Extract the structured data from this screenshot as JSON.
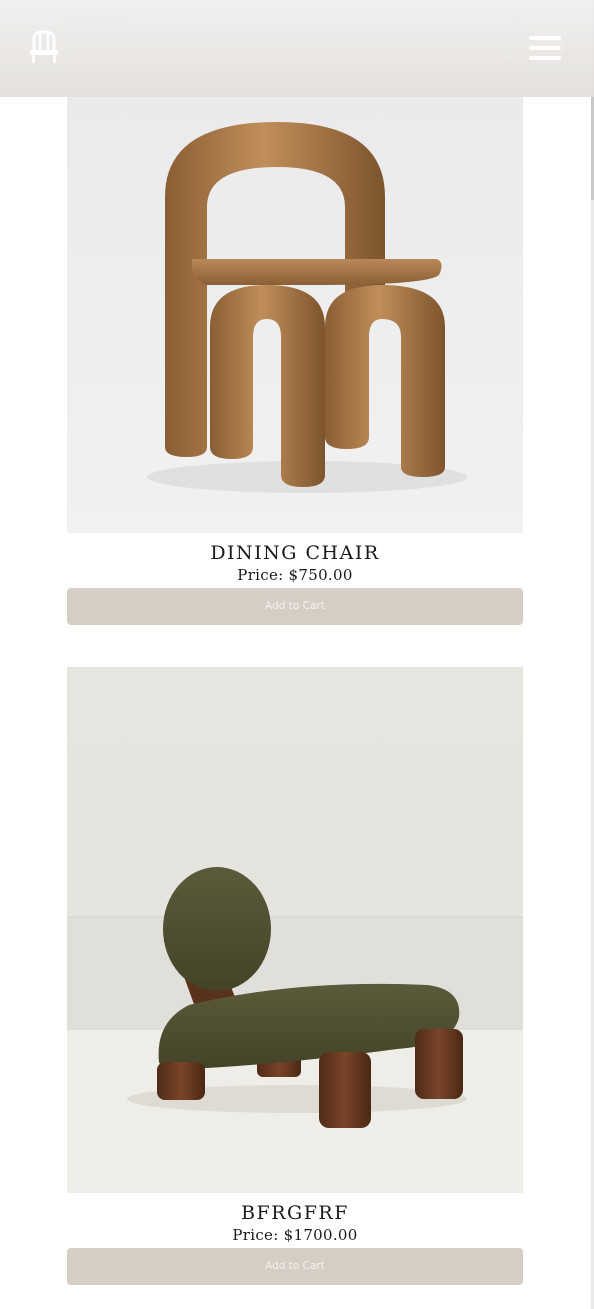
{
  "header": {
    "logo_icon": "chair-icon",
    "menu_icon": "hamburger-menu-icon"
  },
  "products": [
    {
      "name": "DINING CHAIR",
      "price": "Price: $750.00",
      "add_label": "Add to Cart",
      "image_desc_icon": "wooden-arch-chair-image"
    },
    {
      "name": "BFRGFRF",
      "price": "Price: $1700.00",
      "add_label": "Add to Cart",
      "image_desc_icon": "olive-lounge-chair-image"
    }
  ],
  "colors": {
    "header_bg": "#e4e0db",
    "button_bg": "#d6cdc5",
    "button_text": "#f5f1ed",
    "text": "#1a1a1a"
  }
}
